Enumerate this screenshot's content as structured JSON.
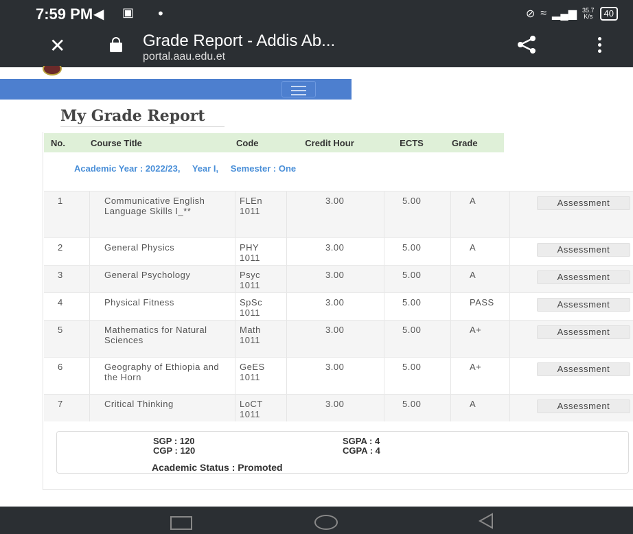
{
  "status_bar": {
    "time": "7:59 PM",
    "net_speed_value": "35.7",
    "net_speed_unit": "K/s",
    "battery": "40"
  },
  "browser": {
    "title": "Grade Report - Addis Ab...",
    "url": "portal.aau.edu.et"
  },
  "heading": "My Grade Report",
  "table": {
    "headers": [
      "No.",
      "Course Title",
      "Code",
      "Credit Hour",
      "ECTS",
      "Grade"
    ],
    "academic_year": "Academic Year : 2022/23,",
    "year": "Year I,",
    "semester": "Semester : One",
    "rows": [
      {
        "no": "1",
        "title": "Communicative English Language Skills I_**",
        "code": "FLEn 1011",
        "credit": "3.00",
        "ects": "5.00",
        "grade": "A",
        "action": "Assessment"
      },
      {
        "no": "2",
        "title": "General Physics",
        "code": "PHY 1011",
        "credit": "3.00",
        "ects": "5.00",
        "grade": "A",
        "action": "Assessment"
      },
      {
        "no": "3",
        "title": "General Psychology",
        "code": "Psyc 1011",
        "credit": "3.00",
        "ects": "5.00",
        "grade": "A",
        "action": "Assessment"
      },
      {
        "no": "4",
        "title": "Physical Fitness",
        "code": "SpSc 1011",
        "credit": "3.00",
        "ects": "5.00",
        "grade": "PASS",
        "action": "Assessment"
      },
      {
        "no": "5",
        "title": "Mathematics for Natural Sciences",
        "code": "Math 1011",
        "credit": "3.00",
        "ects": "5.00",
        "grade": "A+",
        "action": "Assessment"
      },
      {
        "no": "6",
        "title": "Geography of Ethiopia and the Horn",
        "code": "GeES 1011",
        "credit": "3.00",
        "ects": "5.00",
        "grade": "A+",
        "action": "Assessment"
      },
      {
        "no": "7",
        "title": "Critical Thinking",
        "code": "LoCT 1011",
        "credit": "3.00",
        "ects": "5.00",
        "grade": "A",
        "action": "Assessment"
      }
    ]
  },
  "summary": {
    "sgp": "SGP : 120",
    "cgp": "CGP : 120",
    "sgpa": "SGPA : 4",
    "cgpa": "CGPA : 4",
    "status": "Academic Status : Promoted"
  },
  "colors": {
    "chrome": "#2b2f33",
    "navbar": "#4d7fcf",
    "header_bg": "#dff0d8",
    "link_blue": "#4a8fd8"
  }
}
